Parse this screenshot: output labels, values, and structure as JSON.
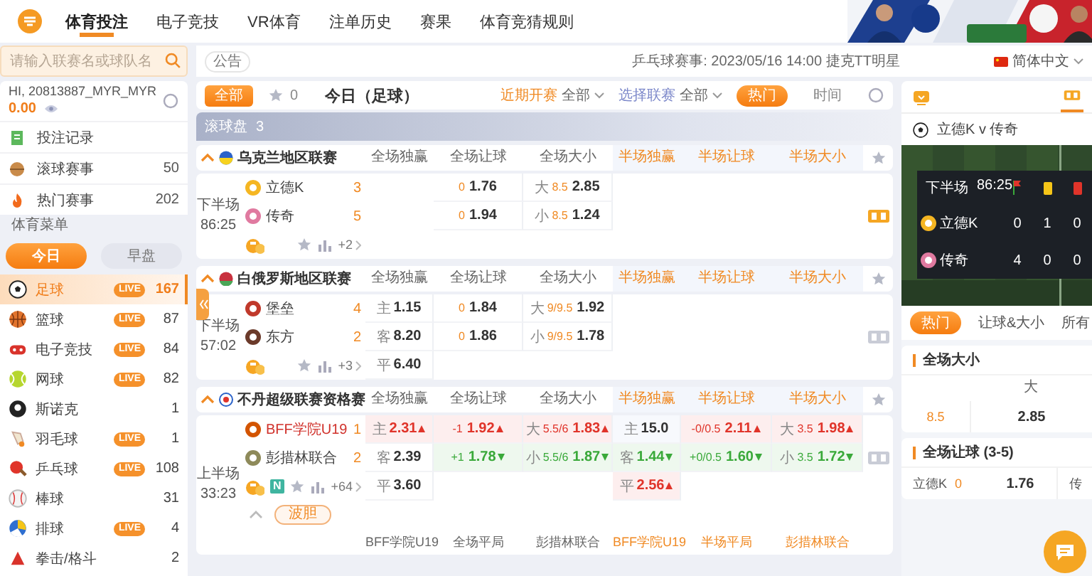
{
  "nav": {
    "items": [
      {
        "label": "体育投注",
        "selected": true
      },
      {
        "label": "电子竞技",
        "selected": false
      },
      {
        "label": "VR体育",
        "selected": false
      },
      {
        "label": "注单历史",
        "selected": false
      },
      {
        "label": "赛果",
        "selected": false
      },
      {
        "label": "体育竞猜规则",
        "selected": false
      }
    ]
  },
  "search": {
    "placeholder": "请输入联赛名或球队名"
  },
  "notice": {
    "label": "公告",
    "text": "乒乓球赛事: 2023/05/16 14:00 捷克TT明星"
  },
  "language": {
    "label": "简体中文"
  },
  "account": {
    "greeting": "HI, 20813887_MYR_MYR",
    "balance": "0.00"
  },
  "quick_links": [
    {
      "label": "投注记录"
    },
    {
      "label": "滚球赛事",
      "count": "50"
    },
    {
      "label": "热门赛事",
      "count": "202"
    }
  ],
  "sports_menu": {
    "title": "体育菜单",
    "periods": [
      {
        "label": "今日",
        "selected": true
      },
      {
        "label": "早盘",
        "selected": false
      }
    ],
    "sports": [
      {
        "name": "足球",
        "badge": "LIVE",
        "count": "167",
        "selected": true
      },
      {
        "name": "篮球",
        "badge": "LIVE",
        "count": "87",
        "selected": false
      },
      {
        "name": "电子竞技",
        "badge": "LIVE",
        "count": "84",
        "selected": false
      },
      {
        "name": "网球",
        "badge": "LIVE",
        "count": "82",
        "selected": false
      },
      {
        "name": "斯诺克",
        "count": "1",
        "selected": false
      },
      {
        "name": "羽毛球",
        "badge": "LIVE",
        "count": "1",
        "selected": false
      },
      {
        "name": "乒乓球",
        "badge": "LIVE",
        "count": "108",
        "selected": false
      },
      {
        "name": "棒球",
        "count": "31",
        "selected": false
      },
      {
        "name": "排球",
        "badge": "LIVE",
        "count": "4",
        "selected": false
      },
      {
        "name": "拳击/格斗",
        "count": "2",
        "selected": false
      }
    ]
  },
  "toolbar": {
    "all_label": "全部",
    "favorites": "0",
    "title": "今日（足球）",
    "filters": [
      {
        "label": "近期开赛",
        "value": "全部"
      },
      {
        "label": "选择联赛",
        "value": "全部"
      }
    ],
    "sorts": [
      {
        "label": "热门",
        "selected": true
      },
      {
        "label": "时间",
        "selected": false
      }
    ]
  },
  "section": {
    "title": "滚球盘",
    "count": "3"
  },
  "leagues": [
    {
      "name": "乌克兰地区联赛",
      "expanded": true,
      "columns": [
        {
          "label": "全场独赢",
          "half": false
        },
        {
          "label": "全场让球",
          "half": false
        },
        {
          "label": "全场大小",
          "half": false
        },
        {
          "label": "半场独赢",
          "half": true
        },
        {
          "label": "半场让球",
          "half": true
        },
        {
          "label": "半场大小",
          "half": true
        }
      ],
      "matches": [
        {
          "period": "下半场",
          "clock": "86:25",
          "selected": true,
          "more": "+2",
          "teams": [
            {
              "name": "立德K",
              "score": "3",
              "highlight": false
            },
            {
              "name": "传奇",
              "score": "5",
              "highlight": false
            }
          ],
          "odds": [
            {
              "full_handicap": {
                "line": "0",
                "price": "1.76",
                "rising": false,
                "falling": false
              },
              "full_total": {
                "tag": "大",
                "line": "8.5",
                "price": "2.85",
                "rising": false,
                "falling": false
              }
            },
            {
              "full_handicap": {
                "line": "0",
                "price": "1.94",
                "rising": false,
                "falling": false
              },
              "full_total": {
                "tag": "小",
                "line": "8.5",
                "price": "1.24",
                "rising": false,
                "falling": false
              }
            }
          ]
        }
      ]
    },
    {
      "name": "白俄罗斯地区联赛",
      "expanded": true,
      "columns": [
        {
          "label": "全场独赢",
          "half": false
        },
        {
          "label": "全场让球",
          "half": false
        },
        {
          "label": "全场大小",
          "half": false
        },
        {
          "label": "半场独赢",
          "half": true
        },
        {
          "label": "半场让球",
          "half": true
        },
        {
          "label": "半场大小",
          "half": true
        }
      ],
      "matches": [
        {
          "period": "下半场",
          "clock": "57:02",
          "selected": false,
          "more": "+3",
          "teams": [
            {
              "name": "堡垒",
              "score": "4",
              "highlight": false
            },
            {
              "name": "东方",
              "score": "2",
              "highlight": false
            }
          ],
          "odds": [
            {
              "full_win": {
                "tag": "主",
                "price": "1.15",
                "rising": false,
                "falling": false
              },
              "full_handicap": {
                "line": "0",
                "price": "1.84",
                "rising": false,
                "falling": false
              },
              "full_total": {
                "tag": "大",
                "line": "9/9.5",
                "price": "1.92",
                "rising": false,
                "falling": false
              }
            },
            {
              "full_win": {
                "tag": "客",
                "price": "8.20",
                "rising": false,
                "falling": false
              },
              "full_handicap": {
                "line": "0",
                "price": "1.86",
                "rising": false,
                "falling": false
              },
              "full_total": {
                "tag": "小",
                "line": "9/9.5",
                "price": "1.78",
                "rising": false,
                "falling": false
              }
            },
            {
              "full_win": {
                "tag": "平",
                "price": "6.40",
                "rising": false,
                "falling": false
              }
            }
          ]
        }
      ]
    },
    {
      "name": "不丹超级联赛资格赛",
      "expanded": true,
      "columns": [
        {
          "label": "全场独赢",
          "half": false
        },
        {
          "label": "全场让球",
          "half": false
        },
        {
          "label": "全场大小",
          "half": false
        },
        {
          "label": "半场独赢",
          "half": true
        },
        {
          "label": "半场让球",
          "half": true
        },
        {
          "label": "半场大小",
          "half": true
        }
      ],
      "matches": [
        {
          "period": "上半场",
          "clock": "33:23",
          "selected": false,
          "badge": "N",
          "more": "+64",
          "teams": [
            {
              "name": "BFF学院U19",
              "score": "1",
              "highlight": true
            },
            {
              "name": "彭措林联合",
              "score": "2",
              "highlight": false
            }
          ],
          "odds": [
            {
              "full_win": {
                "tag": "主",
                "price": "2.31",
                "rising": true,
                "falling": false
              },
              "full_handicap": {
                "line": "-1",
                "price": "1.92",
                "rising": true,
                "falling": false
              },
              "full_total": {
                "tag": "大",
                "line": "5.5/6",
                "price": "1.83",
                "rising": true,
                "falling": false
              },
              "half_win": {
                "tag": "主",
                "price": "15.0",
                "rising": false,
                "falling": false
              },
              "half_handicap": {
                "line": "-0/0.5",
                "price": "2.11",
                "rising": true,
                "falling": false
              },
              "half_total": {
                "tag": "大",
                "line": "3.5",
                "price": "1.98",
                "rising": true,
                "falling": false
              }
            },
            {
              "full_win": {
                "tag": "客",
                "price": "2.39",
                "rising": false,
                "falling": false
              },
              "full_handicap": {
                "line": "+1",
                "price": "1.78",
                "rising": false,
                "falling": true
              },
              "full_total": {
                "tag": "小",
                "line": "5.5/6",
                "price": "1.87",
                "rising": false,
                "falling": true
              },
              "half_win": {
                "tag": "客",
                "price": "1.44",
                "rising": false,
                "falling": true
              },
              "half_handicap": {
                "line": "+0/0.5",
                "price": "1.60",
                "rising": false,
                "falling": true
              },
              "half_total": {
                "tag": "小",
                "line": "3.5",
                "price": "1.72",
                "rising": false,
                "falling": true
              }
            },
            {
              "full_win": {
                "tag": "平",
                "price": "3.60",
                "rising": false,
                "falling": false
              },
              "half_win": {
                "tag": "平",
                "price": "2.56",
                "rising": true,
                "falling": false
              }
            }
          ],
          "correct_score": {
            "label": "波胆",
            "expanded": true,
            "columns": [
              {
                "label": "BFF学院U19",
                "half": false
              },
              {
                "label": "全场平局",
                "half": false
              },
              {
                "label": "彭措林联合",
                "half": false
              },
              {
                "label": "BFF学院U19",
                "half": true
              },
              {
                "label": "半场平局",
                "half": true
              },
              {
                "label": "彭措林联合",
                "half": true
              }
            ]
          }
        }
      ]
    }
  ],
  "live_panel": {
    "title": "立德K v 传奇",
    "scoreboard": {
      "period": "下半场",
      "clock": "86:25",
      "rows": [
        {
          "team": "立德K",
          "corners": "0",
          "yellow_cards": "1",
          "red_cards": "0"
        },
        {
          "team": "传奇",
          "corners": "4",
          "yellow_cards": "0",
          "red_cards": "0"
        }
      ]
    },
    "tabs": [
      {
        "label": "热门",
        "selected": true
      },
      {
        "label": "让球&大小",
        "selected": false
      },
      {
        "label": "所有",
        "selected": false
      }
    ],
    "markets": [
      {
        "kind": "total",
        "title": "全场大小",
        "header": "大",
        "line": "8.5",
        "price": "2.85"
      },
      {
        "kind": "handicap",
        "title": "全场让球 (3-5)",
        "team": "立德K",
        "line": "0",
        "price": "1.76",
        "next_team": "传"
      }
    ]
  }
}
